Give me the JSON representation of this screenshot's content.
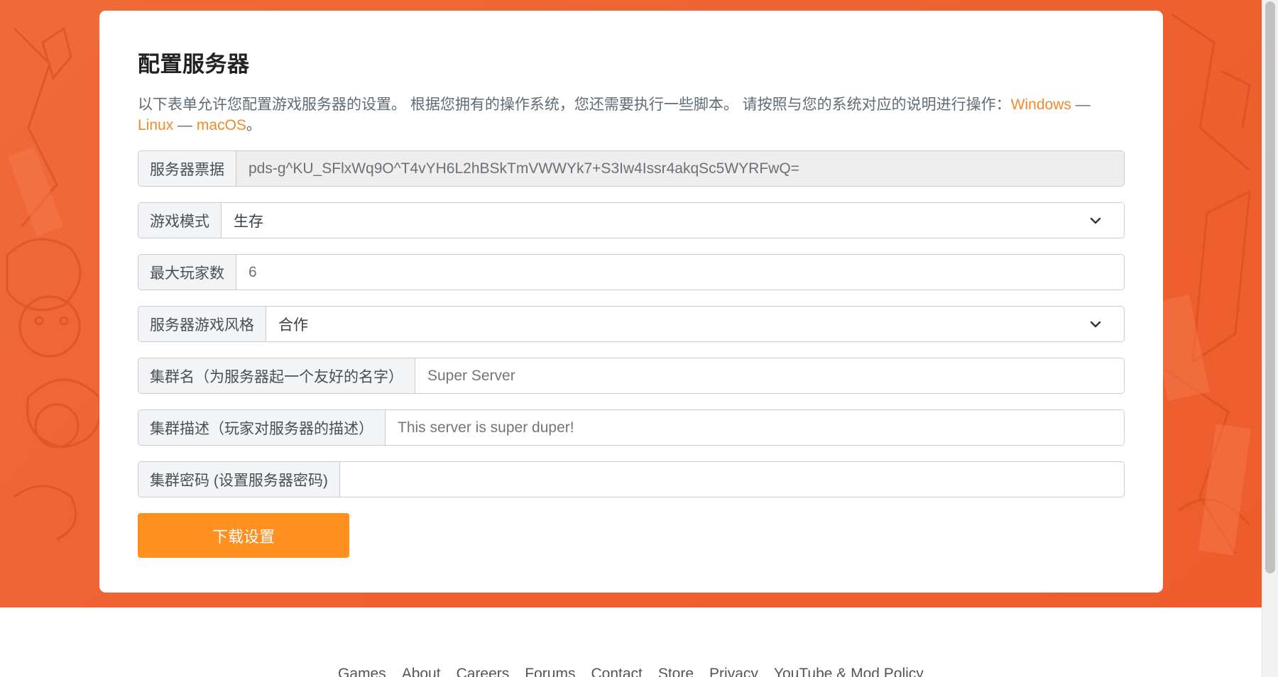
{
  "form": {
    "title": "配置服务器",
    "description_prefix": "以下表单允许您配置游戏服务器的设置。 根据您拥有的操作系统，您还需要执行一些脚本。 请按照与您的系统对应的说明进行操作：",
    "os_links": {
      "windows": "Windows",
      "linux": "Linux",
      "macos": "macOS",
      "separator": "—",
      "end": "。"
    },
    "fields": {
      "server_ticket": {
        "label": "服务器票据",
        "value": "pds-g^KU_SFlxWq9O^T4vYH6L2hBSkTmVWWYk7+S3Iw4Issr4akqSc5WYRFwQ="
      },
      "game_mode": {
        "label": "游戏模式",
        "value": "生存"
      },
      "max_players": {
        "label": "最大玩家数",
        "value": "6"
      },
      "server_style": {
        "label": "服务器游戏风格",
        "value": "合作"
      },
      "cluster_name": {
        "label": "集群名（为服务器起一个友好的名字）",
        "placeholder": "Super Server"
      },
      "cluster_description": {
        "label": "集群描述（玩家对服务器的描述）",
        "placeholder": "This server is super duper!"
      },
      "cluster_password": {
        "label": "集群密码 (设置服务器密码)",
        "value": ""
      }
    },
    "download_button": "下载设置"
  },
  "footer": {
    "links": [
      "Games",
      "About",
      "Careers",
      "Forums",
      "Contact",
      "Store",
      "Privacy",
      "YouTube & Mod Policy"
    ]
  },
  "colors": {
    "accent": "#f28a2c",
    "button": "#ff8f1f",
    "background": "#ef6232"
  },
  "icons": {
    "select_arrow": "chevron-down-icon"
  }
}
